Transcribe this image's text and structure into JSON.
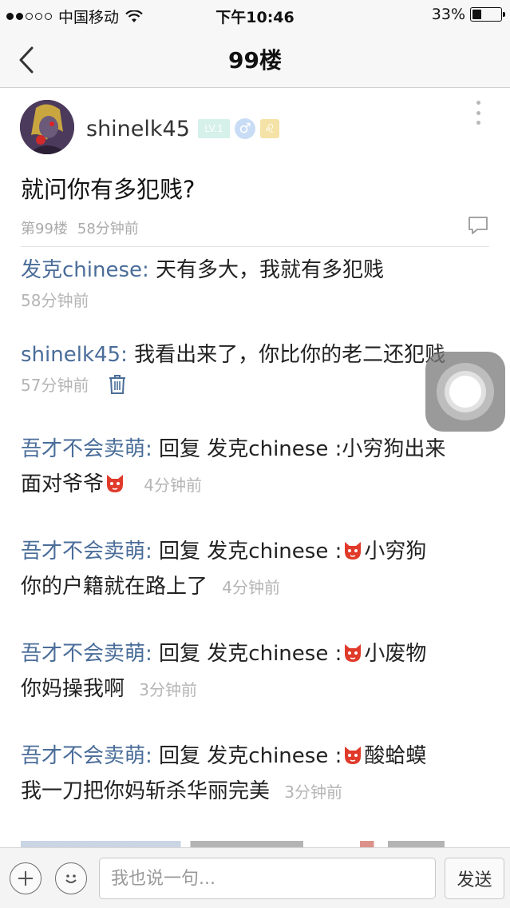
{
  "status_bar": {
    "carrier": "中国移动",
    "time": "下午10:46",
    "battery": "33%",
    "battery_level": 0.33
  },
  "nav": {
    "title": "99楼"
  },
  "post": {
    "username": "shinelk45",
    "level_badge": "LV.1",
    "gender_symbol": "♂",
    "zodiac_symbol": "♌",
    "text": "就问你有多犯贱?",
    "floor": "第99楼",
    "time": "58分钟前"
  },
  "replies": [
    {
      "author": "发克chinese:",
      "text": " 天有多大，我就有多犯贱",
      "time": "58分钟前"
    },
    {
      "author": "shinelk45:",
      "text": " 我看出来了，你比你的老二还犯贱",
      "time": "57分钟前"
    },
    {
      "author": "吾才不会卖萌:",
      "text": " 回复 发克chinese :小穷狗出来",
      "text2": "面对爷爷",
      "time": "4分钟前",
      "emoji": "fox-face-emoji"
    },
    {
      "author": "吾才不会卖萌:",
      "text": " 回复 发克chinese :",
      "text_after": "小穷狗",
      "text2": "你的户籍就在路上了",
      "time": "4分钟前",
      "emoji": "fox-face-emoji"
    },
    {
      "author": "吾才不会卖萌:",
      "text": " 回复 发克chinese :",
      "text_after": "小废物",
      "text2": "你妈操我啊",
      "time": "3分钟前",
      "emoji": "fox-face-emoji"
    },
    {
      "author": "吾才不会卖萌:",
      "text": " 回复 发克chinese :",
      "text_after": "酸蛤蟆",
      "text2": "我一刀把你妈斩杀华丽完美",
      "time": "3分钟前",
      "emoji": "fox-face-emoji"
    }
  ],
  "bottom_bar": {
    "input_placeholder": "我也说一句...",
    "send_label": "发送"
  },
  "colors": {
    "author_link": "#4a6d99",
    "meta_gray": "#aaaaaa"
  }
}
